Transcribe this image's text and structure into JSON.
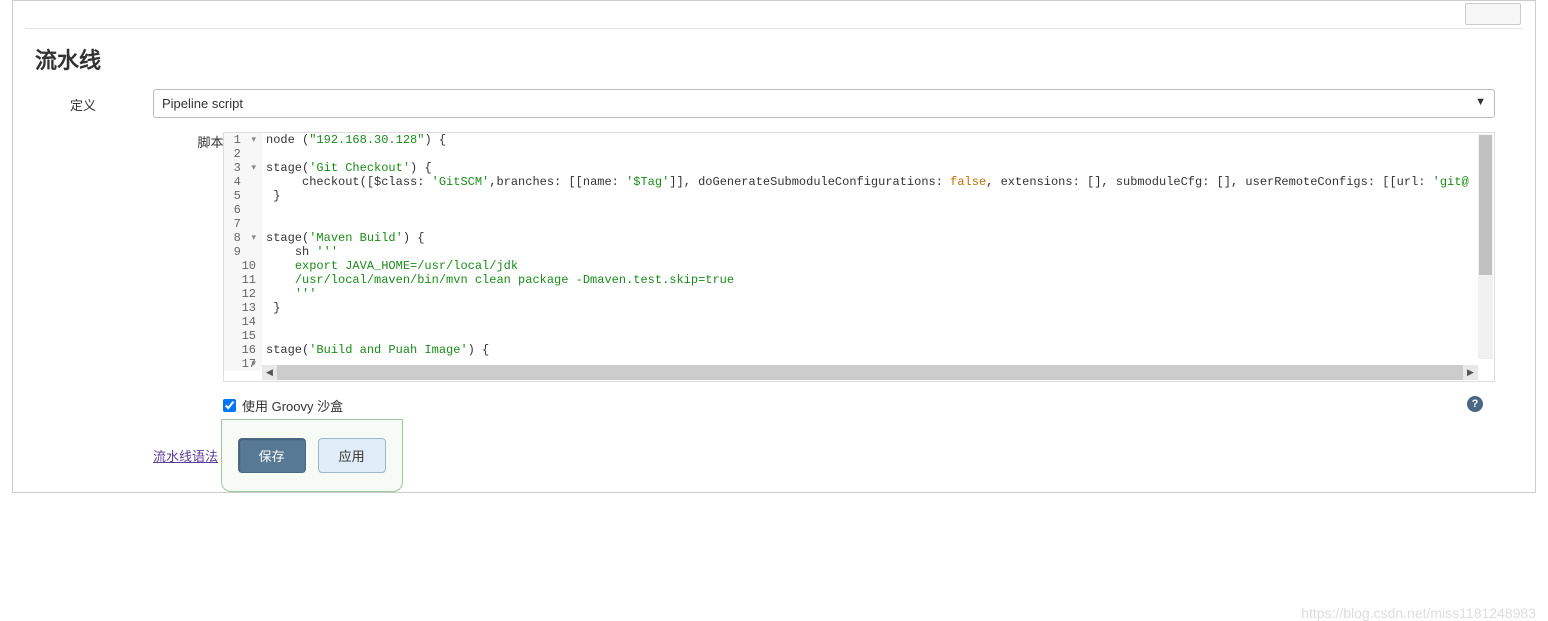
{
  "section": {
    "title": "流水线"
  },
  "form": {
    "definition_label": "定义",
    "definition_value": "Pipeline script",
    "script_label": "脚本",
    "sandbox_label": "使用 Groovy 沙盒",
    "syntax_link": "流水线语法"
  },
  "code": {
    "lines": [
      {
        "n": 1,
        "fold": true,
        "t": "node (",
        "s": "\"192.168.30.128\"",
        "r": ") {"
      },
      {
        "n": 2,
        "t": ""
      },
      {
        "n": 3,
        "fold": true,
        "t": "stage(",
        "s": "'Git Checkout'",
        "r": ") {"
      },
      {
        "n": 4,
        "indent": "     ",
        "t": "checkout([$class: ",
        "s": "'GitSCM'",
        "r1": ",branches: [[name: ",
        "s2": "'$Tag'",
        "r2": "]], doGenerateSubmoduleConfigurations: ",
        "bool": "false",
        "r3": ", extensions: [], submoduleCfg: [], userRemoteConfigs: [[url: ",
        "s3": "'git@"
      },
      {
        "n": 5,
        "t": " }"
      },
      {
        "n": 6,
        "t": ""
      },
      {
        "n": 7,
        "t": ""
      },
      {
        "n": 8,
        "fold": true,
        "t": "stage(",
        "s": "'Maven Build'",
        "r": ") {"
      },
      {
        "n": 9,
        "indent": "    ",
        "t": "sh ",
        "s": "'''"
      },
      {
        "n": 10,
        "indent": "    ",
        "s": "export JAVA_HOME=/usr/local/jdk"
      },
      {
        "n": 11,
        "indent": "    ",
        "s": "/usr/local/maven/bin/mvn clean package -Dmaven.test.skip=true"
      },
      {
        "n": 12,
        "indent": "    ",
        "s": "'''"
      },
      {
        "n": 13,
        "t": " }"
      },
      {
        "n": 14,
        "t": ""
      },
      {
        "n": 15,
        "t": ""
      },
      {
        "n": 16,
        "fold": true,
        "t": "stage(",
        "s": "'Build and Puah Image'",
        "r": ") {"
      },
      {
        "n": 17,
        "t": ""
      }
    ]
  },
  "buttons": {
    "save": "保存",
    "apply": "应用"
  },
  "watermark": "https://blog.csdn.net/miss1181248983"
}
